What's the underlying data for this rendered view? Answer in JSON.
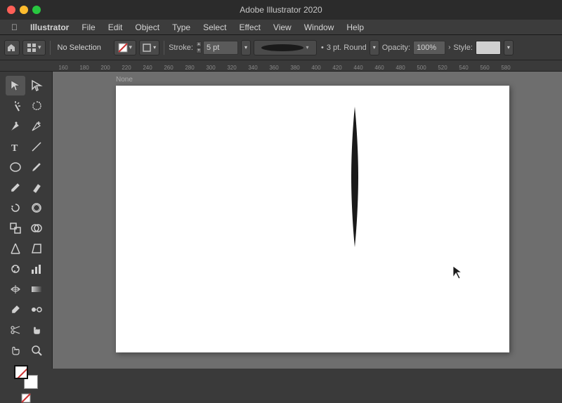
{
  "titleBar": {
    "title": "Adobe Illustrator 2020"
  },
  "menuBar": {
    "items": [
      {
        "label": "🍎",
        "id": "apple"
      },
      {
        "label": "Illustrator",
        "id": "illustrator"
      },
      {
        "label": "File",
        "id": "file"
      },
      {
        "label": "Edit",
        "id": "edit"
      },
      {
        "label": "Object",
        "id": "object"
      },
      {
        "label": "Type",
        "id": "type"
      },
      {
        "label": "Select",
        "id": "select"
      },
      {
        "label": "Effect",
        "id": "effect"
      },
      {
        "label": "View",
        "id": "view"
      },
      {
        "label": "Window",
        "id": "window"
      },
      {
        "label": "Help",
        "id": "help"
      }
    ]
  },
  "controlBar": {
    "selection": "No Selection",
    "strokeLabel": "Stroke:",
    "strokeValue": "5 pt",
    "brushLabel": "",
    "roundLabel": "3 pt. Round",
    "opacityLabel": "Opacity:",
    "opacityValue": "100%",
    "styleLabel": "Style:"
  },
  "ruler": {
    "marks": [
      "160",
      "180",
      "200",
      "220",
      "240",
      "260",
      "280",
      "300",
      "320",
      "340",
      "360",
      "380",
      "400",
      "420",
      "440",
      "460",
      "480",
      "500",
      "520",
      "540",
      "560",
      "580"
    ]
  },
  "leftToolbar": {
    "tools": [
      {
        "name": "selection-tool",
        "icon": "▶",
        "active": true
      },
      {
        "name": "direct-selection-tool",
        "icon": "◁",
        "active": false
      },
      {
        "name": "magic-wand-tool",
        "icon": "✦",
        "active": false
      },
      {
        "name": "lasso-tool",
        "icon": "⌒",
        "active": false
      },
      {
        "name": "pen-tool",
        "icon": "✒",
        "active": false
      },
      {
        "name": "add-anchor-tool",
        "icon": "+",
        "active": false
      },
      {
        "name": "type-tool",
        "icon": "T",
        "active": false
      },
      {
        "name": "line-tool",
        "icon": "╲",
        "active": false
      },
      {
        "name": "ellipse-tool",
        "icon": "○",
        "active": false
      },
      {
        "name": "paintbrush-tool",
        "icon": "🖌",
        "active": false
      },
      {
        "name": "pencil-tool",
        "icon": "✏",
        "active": false
      },
      {
        "name": "rotate-tool",
        "icon": "↺",
        "active": false
      },
      {
        "name": "warp-tool",
        "icon": "⊡",
        "active": false
      },
      {
        "name": "scale-tool",
        "icon": "⊞",
        "active": false
      },
      {
        "name": "shape-builder-tool",
        "icon": "⊕",
        "active": false
      },
      {
        "name": "perspective-tool",
        "icon": "⬚",
        "active": false
      },
      {
        "name": "symbol-sprayer-tool",
        "icon": "☁",
        "active": false
      },
      {
        "name": "column-graph-tool",
        "icon": "▦",
        "active": false
      },
      {
        "name": "mesh-tool",
        "icon": "⊟",
        "active": false
      },
      {
        "name": "gradient-tool",
        "icon": "◩",
        "active": false
      },
      {
        "name": "eyedropper-tool",
        "icon": "𝒾",
        "active": false
      },
      {
        "name": "blend-tool",
        "icon": "⋈",
        "active": false
      },
      {
        "name": "scissors-tool",
        "icon": "✂",
        "active": false
      },
      {
        "name": "hand-tool",
        "icon": "✋",
        "active": false
      },
      {
        "name": "zoom-tool",
        "icon": "⌕",
        "active": false
      },
      {
        "name": "eraser-tool",
        "icon": "⎌",
        "active": false
      }
    ]
  },
  "canvas": {
    "label": "None"
  }
}
